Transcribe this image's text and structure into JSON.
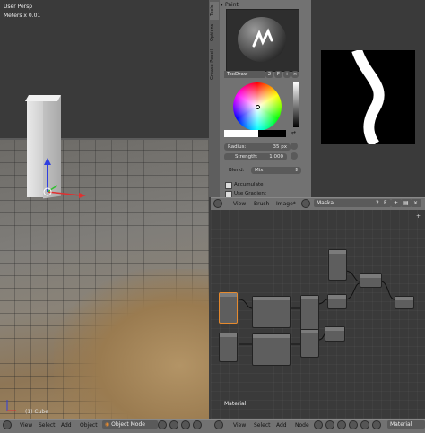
{
  "viewport": {
    "persp_label": "User Persp",
    "scale_label": "Meters x 0.01",
    "bottom_text": "(1) Cube"
  },
  "tools_panel": {
    "tabs": [
      "Tools",
      "Options",
      "Grease Pencil"
    ],
    "title": "Paint",
    "brush_name": "TexDraw",
    "brush_users": "2",
    "brush_fake": "F",
    "radius_label": "Radius:",
    "radius_value": "35 px",
    "strength_label": "Strength:",
    "strength_value": "1.000",
    "blend_label": "Blend:",
    "blend_value": "Mix",
    "accumulate_label": "Accumulate",
    "use_gradient_label": "Use Gradient"
  },
  "image_header": {
    "view": "View",
    "brush": "Brush",
    "image": "Image*",
    "image_name": "Maska",
    "users": "2",
    "fake": "F"
  },
  "node_editor": {
    "label": "Material"
  },
  "bottom_left": {
    "view": "View",
    "select": "Select",
    "add": "Add",
    "object": "Object",
    "mode": "Object Mode"
  },
  "bottom_right": {
    "view": "View",
    "select": "Select",
    "add": "Add",
    "node": "Node",
    "material": "Material"
  },
  "colors": {
    "panel": "#727272",
    "editor_bg": "#3a3a3a",
    "selected_node": "#e68a2e",
    "axis_x": "#e03030",
    "axis_y": "#30c030",
    "axis_z": "#3040e0"
  }
}
